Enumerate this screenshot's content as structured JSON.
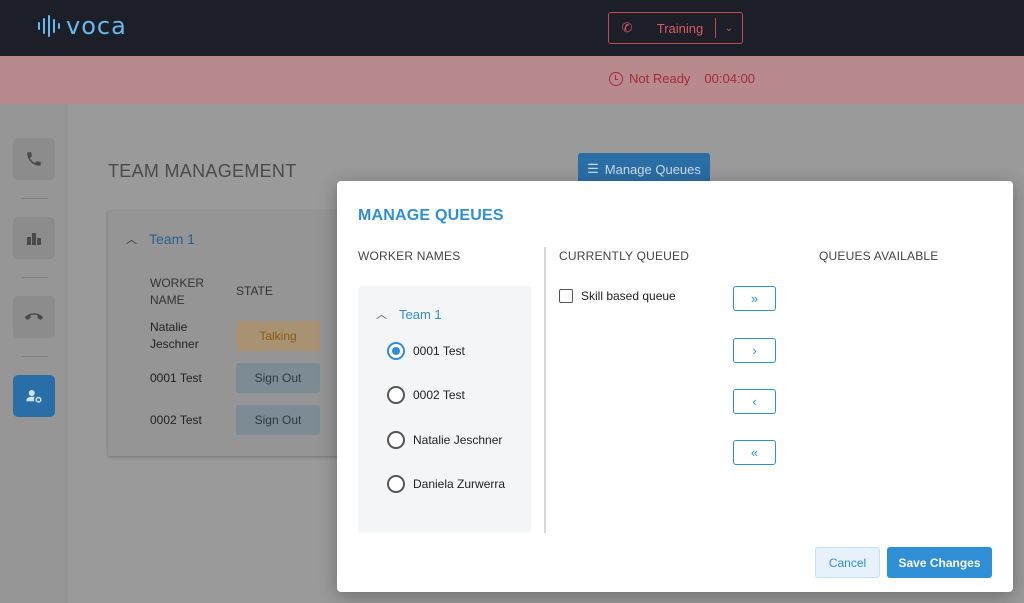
{
  "app": {
    "logo_text": "voca"
  },
  "header": {
    "training": {
      "icon": "phone-muted-icon",
      "label": "Training",
      "dropdown_icon": "chevron-down-icon"
    }
  },
  "status": {
    "label": "Not Ready",
    "timer": "00:04:00",
    "color": "#a32b38"
  },
  "sidebar": {
    "items": [
      {
        "name": "phone",
        "icon": "phone-icon",
        "active": false
      },
      {
        "name": "stats",
        "icon": "bar-chart-icon",
        "active": false
      },
      {
        "name": "hangup",
        "icon": "phone-hangup-icon",
        "active": false
      },
      {
        "name": "team",
        "icon": "team-settings-icon",
        "active": true
      }
    ]
  },
  "main": {
    "title": "TEAM MANAGEMENT",
    "manage_queues_label": "Manage Queues",
    "team_card": {
      "team_name": "Team 1",
      "columns": {
        "worker_name": "WORKER NAME",
        "state": "STATE"
      },
      "rows": [
        {
          "name": "Natalie Jeschner",
          "state": "Talking"
        },
        {
          "name": "0001 Test",
          "state": "Sign Out"
        },
        {
          "name": "0002 Test",
          "state": "Sign Out"
        }
      ]
    }
  },
  "modal": {
    "title": "MANAGE QUEUES",
    "columns": {
      "worker_names": "WORKER NAMES",
      "currently_queued": "CURRENTLY QUEUED",
      "queues_available": "QUEUES AVAILABLE"
    },
    "team_name": "Team 1",
    "workers": [
      {
        "name": "0001 Test",
        "selected": true
      },
      {
        "name": "0002 Test",
        "selected": false
      },
      {
        "name": "Natalie Jeschner",
        "selected": false
      },
      {
        "name": "Daniela Zurwerra",
        "selected": false
      }
    ],
    "queued": [
      {
        "name": "Skill based queue",
        "checked": false
      }
    ],
    "arrows": {
      "move_all_right": "»",
      "move_right": "›",
      "move_left": "‹",
      "move_all_left": "«"
    },
    "cancel_label": "Cancel",
    "save_label": "Save Changes",
    "accent_color": "#2f8fd6"
  }
}
